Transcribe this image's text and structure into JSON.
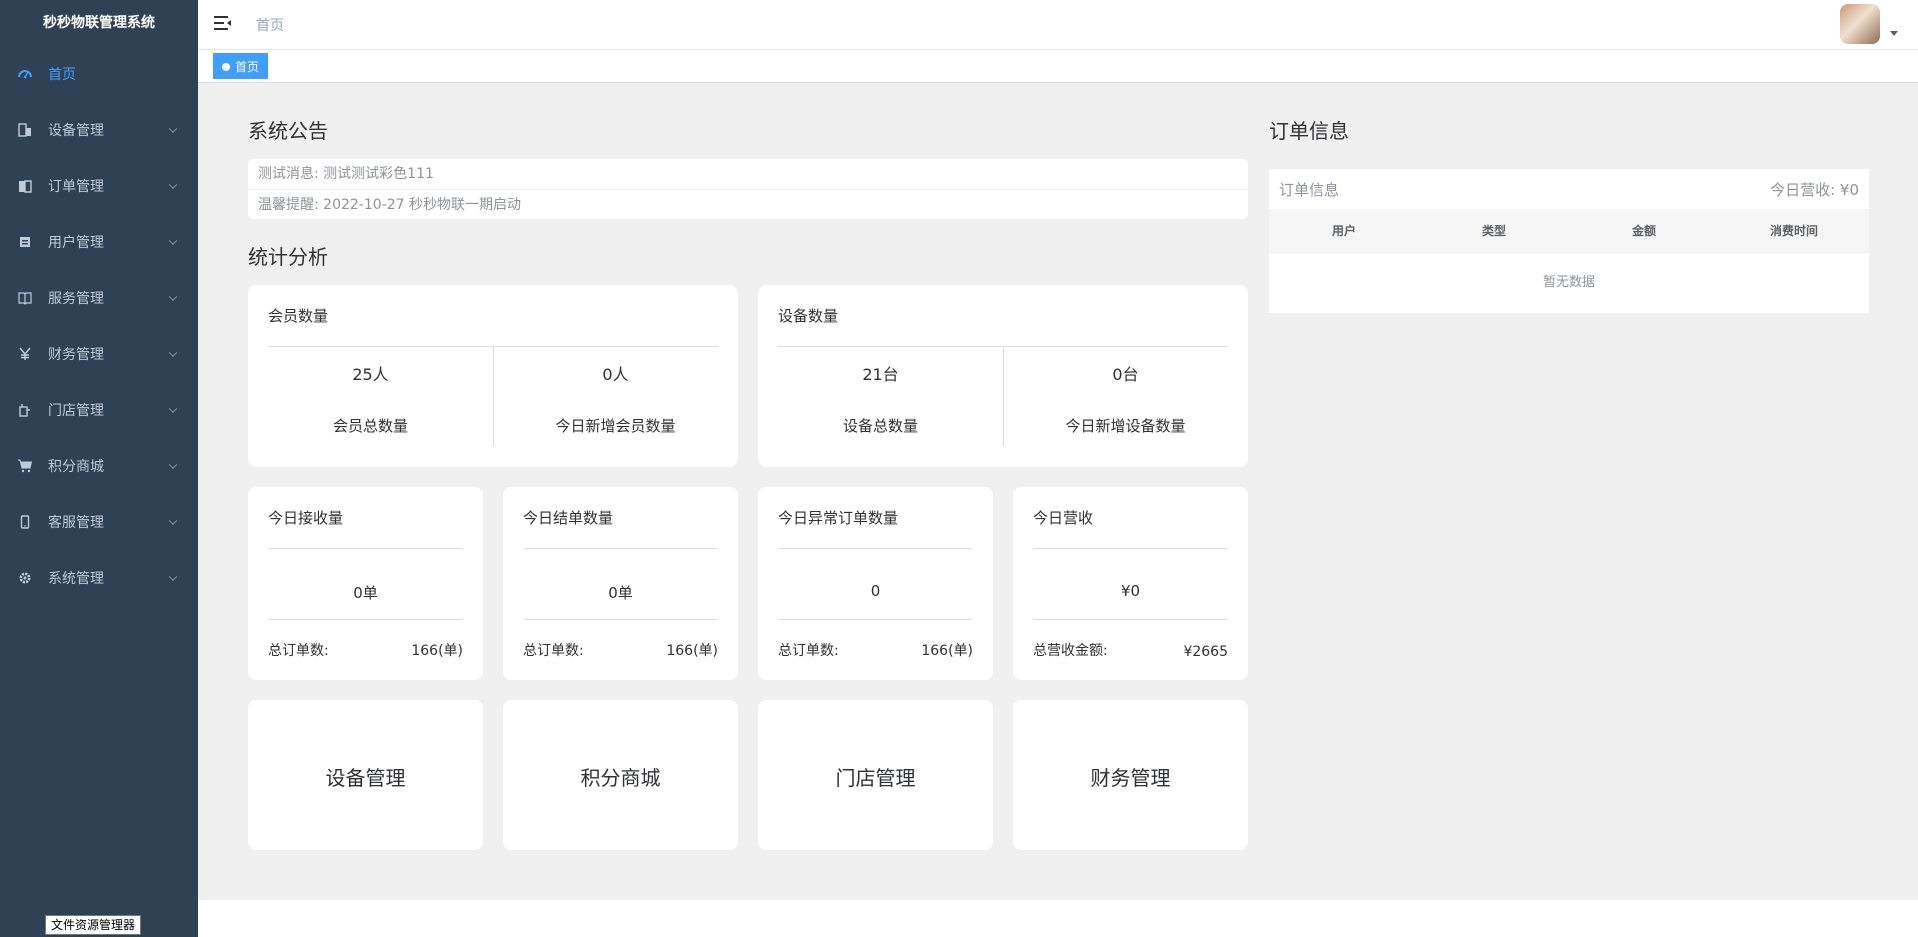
{
  "app": {
    "title": "秒秒物联管理系统"
  },
  "sidebar": {
    "items": [
      {
        "label": "首页",
        "icon": "dashboard-icon"
      },
      {
        "label": "设备管理",
        "icon": "device-icon"
      },
      {
        "label": "订单管理",
        "icon": "order-icon"
      },
      {
        "label": "用户管理",
        "icon": "user-icon"
      },
      {
        "label": "服务管理",
        "icon": "book-icon"
      },
      {
        "label": "财务管理",
        "icon": "yen-icon"
      },
      {
        "label": "门店管理",
        "icon": "store-icon"
      },
      {
        "label": "积分商城",
        "icon": "cart-icon"
      },
      {
        "label": "客服管理",
        "icon": "phone-icon"
      },
      {
        "label": "系统管理",
        "icon": "gear-icon"
      }
    ]
  },
  "navbar": {
    "breadcrumb": "首页"
  },
  "tags": {
    "active": "首页"
  },
  "notice": {
    "title": "系统公告",
    "rows": [
      {
        "label": "测试消息:",
        "value": "测试测试彩色111"
      },
      {
        "label": "温馨提醒:",
        "value": "2022-10-27 秒秒物联一期启动"
      }
    ]
  },
  "stats": {
    "title": "统计分析",
    "members": {
      "title": "会员数量",
      "total": "25人",
      "total_label": "会员总数量",
      "today": "0人",
      "today_label": "今日新增会员数量"
    },
    "devices": {
      "title": "设备数量",
      "total": "21台",
      "total_label": "设备总数量",
      "today": "0台",
      "today_label": "今日新增设备数量"
    },
    "small": [
      {
        "title": "今日接收量",
        "value": "0单",
        "foot_label": "总订单数:",
        "foot_value": "166(单)"
      },
      {
        "title": "今日结单数量",
        "value": "0单",
        "foot_label": "总订单数:",
        "foot_value": "166(单)"
      },
      {
        "title": "今日异常订单数量",
        "value": "0",
        "foot_label": "总订单数:",
        "foot_value": "166(单)"
      },
      {
        "title": "今日营收",
        "value": "¥0",
        "foot_label": "总营收金额:",
        "foot_value": "¥2665"
      }
    ],
    "nav": [
      "设备管理",
      "积分商城",
      "门店管理",
      "财务管理"
    ]
  },
  "orders": {
    "title": "订单信息",
    "panel_title": "订单信息",
    "today_revenue": "今日营收: ¥0",
    "columns": [
      "用户",
      "类型",
      "金额",
      "消费时间"
    ],
    "empty": "暂无数据"
  },
  "tooltip": "文件资源管理器",
  "colors": {
    "sidebar_bg": "#304156",
    "accent": "#409eff",
    "content_bg": "#f0f0f0"
  }
}
